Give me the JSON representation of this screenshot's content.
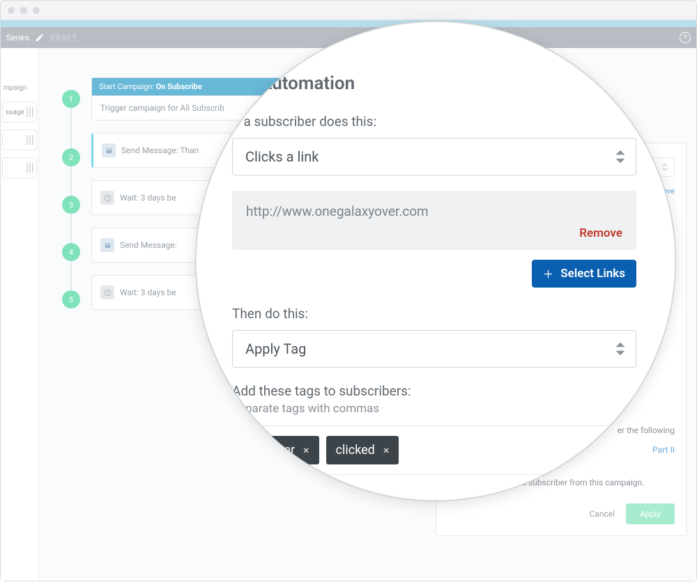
{
  "header": {
    "series": "Series",
    "draft": "DRAFT"
  },
  "sidebar": {
    "campaign": "mpaign",
    "pills": [
      "ssage",
      "",
      ""
    ],
    "bottom": ""
  },
  "timeline": {
    "start_hdr_prefix": "Start Campaign: ",
    "start_hdr_val": "On Subscribe",
    "start_body": "Trigger campaign for All Subscrib",
    "steps": [
      {
        "icon": "mail",
        "text": "Send Message: Than"
      },
      {
        "icon": "clock",
        "text": "Wait: 3 days be"
      },
      {
        "icon": "mail",
        "text": "Send Message:"
      },
      {
        "icon": "clock",
        "text": "Wait: 3 days be"
      }
    ]
  },
  "detail": {
    "remove_link": "ove",
    "following": "er the following",
    "part": "Part II",
    "remove_sub": "Remove the subscriber from this campaign.",
    "cancel": "Cancel",
    "apply": "Apply"
  },
  "lens": {
    "title": "Automation",
    "cond_label": "If a subscriber does this:",
    "cond_value": "Clicks a link",
    "link_url": "http://www.onegalaxyover.com",
    "remove": "Remove",
    "select_links": "Select Links",
    "then_label": "Then do this:",
    "then_value": "Apply Tag",
    "tags_label": "Add these tags to subscribers:",
    "tags_hint": "Separate tags with commas",
    "tags": [
      "customer",
      "clicked"
    ]
  }
}
